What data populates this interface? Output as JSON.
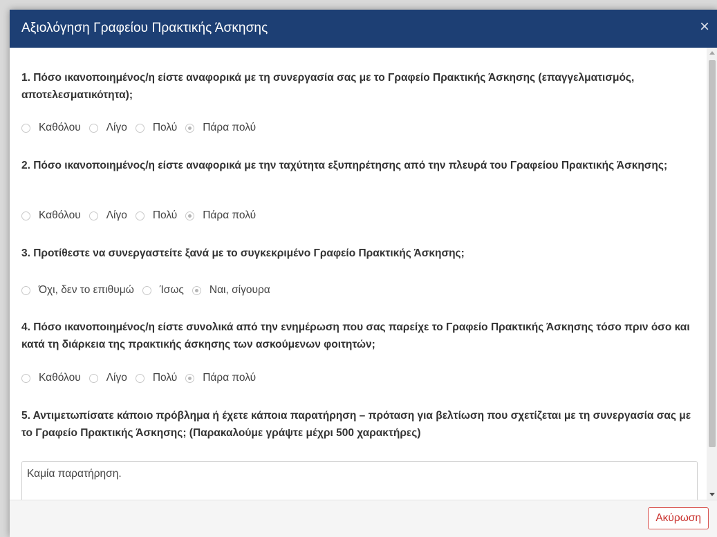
{
  "dialog": {
    "title": "Αξιολόγηση Γραφείου Πρακτικής Άσκησης",
    "close_symbol": "×",
    "cancel_label": "Ακύρωση",
    "colors": {
      "header": "#1d3f74",
      "cancel": "#d9534f"
    }
  },
  "questions": [
    {
      "text": "1. Πόσο ικανοποιημένος/η είστε αναφορικά με τη συνεργασία σας με το Γραφείο Πρακτικής Άσκησης (επαγγελματισμός, αποτελεσματικότητα);",
      "options": [
        "Καθόλου",
        "Λίγο",
        "Πολύ",
        "Πάρα πολύ"
      ],
      "selected": "Πάρα πολύ"
    },
    {
      "text": "2. Πόσο ικανοποιημένος/η είστε αναφορικά με την ταχύτητα εξυπηρέτησης από την πλευρά του Γραφείου Πρακτικής Άσκησης;",
      "options": [
        "Καθόλου",
        "Λίγο",
        "Πολύ",
        "Πάρα πολύ"
      ],
      "selected": "Πάρα πολύ"
    },
    {
      "text": "3. Προτίθεστε να συνεργαστείτε ξανά με το συγκεκριμένο Γραφείο Πρακτικής Άσκησης;",
      "options": [
        "Όχι, δεν το επιθυμώ",
        "Ίσως",
        "Ναι, σίγουρα"
      ],
      "selected": "Ναι, σίγουρα"
    },
    {
      "text": "4. Πόσο ικανοποιημένος/η είστε συνολικά από την ενημέρωση που σας παρείχε το Γραφείο Πρακτικής Άσκησης τόσο πριν όσο και κατά τη διάρκεια της πρακτικής άσκησης των ασκούμενων φοιτητών;",
      "options": [
        "Καθόλου",
        "Λίγο",
        "Πολύ",
        "Πάρα πολύ"
      ],
      "selected": "Πάρα πολύ"
    },
    {
      "text": "5. Αντιμετωπίσατε κάποιο πρόβλημα ή έχετε κάποια παρατήρηση – πρόταση για βελτίωση που σχετίζεται με τη συνεργασία σας με το Γραφείο Πρακτικής Άσκησης; (Παρακαλούμε γράψτε μέχρι 500 χαρακτήρες)",
      "answer_value": "Καμία παρατήρηση."
    }
  ]
}
